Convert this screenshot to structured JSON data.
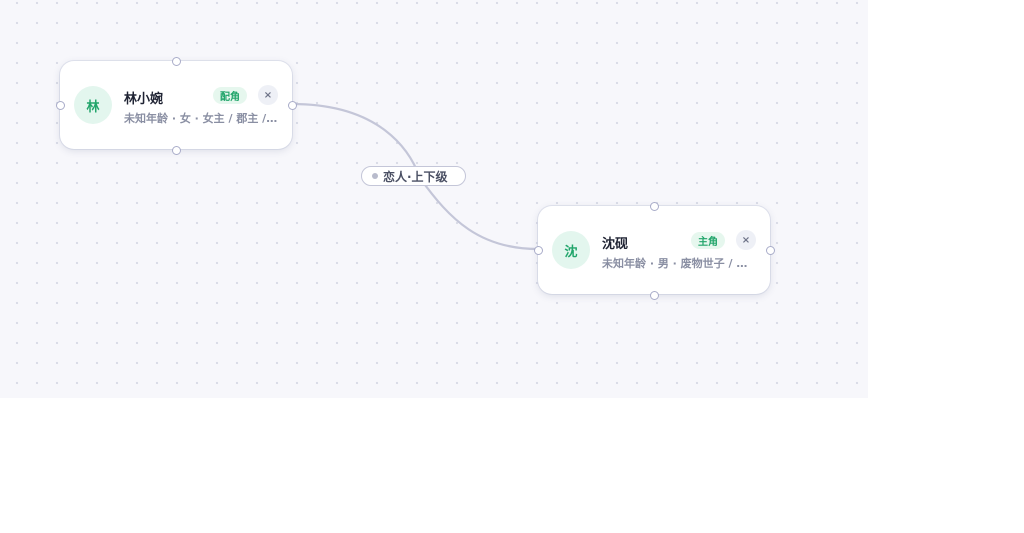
{
  "nodes": [
    {
      "avatar": "林",
      "name": "林小婉",
      "role": "配角",
      "desc": "未知年龄 · 女 · 女主 / 郡主 / …",
      "close_icon": "×"
    },
    {
      "avatar": "沈",
      "name": "沈砚",
      "role": "主角",
      "desc": "未知年龄 · 男 · 废物世子 / 隐…",
      "close_icon": "×"
    }
  ],
  "edge": {
    "label": "恋人·上下级"
  },
  "colors": {
    "accent": "#22a56b",
    "edge": "#c4c6d8",
    "handle": "#a9acc9"
  }
}
